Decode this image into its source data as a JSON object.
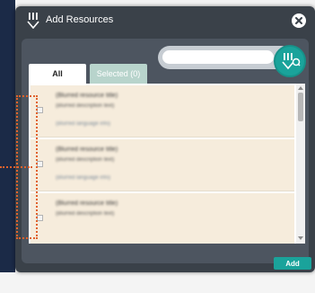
{
  "header": {
    "title": "Add Resources",
    "brand_icon": "pen-marks-icon",
    "close_icon": "close-icon"
  },
  "search": {
    "placeholder": "",
    "value": "",
    "button_icon": "library-search-icon"
  },
  "tabs": [
    {
      "label": "All",
      "active": true
    },
    {
      "label": "Selected (0)",
      "active": false
    }
  ],
  "resources": [
    {
      "title": "(Blurred resource title)",
      "description": "(Blurred description text)",
      "meta": "(Blurred language info)",
      "checked": false
    },
    {
      "title": "(Blurred resource title)",
      "description": "(Blurred description text)",
      "meta": "(Blurred language info)",
      "checked": false
    },
    {
      "title": "(Blurred resource title)",
      "description": "(Blurred description text)",
      "meta": "",
      "checked": false
    }
  ],
  "footer": {
    "add_label": "Add"
  },
  "colors": {
    "accent": "#1aa39b",
    "modal_bg": "#3a4149",
    "panel_bg": "#4d5560",
    "item_bg": "#f6ecdc",
    "highlight": "#e0622c",
    "backdrop": "#1b2a47"
  }
}
